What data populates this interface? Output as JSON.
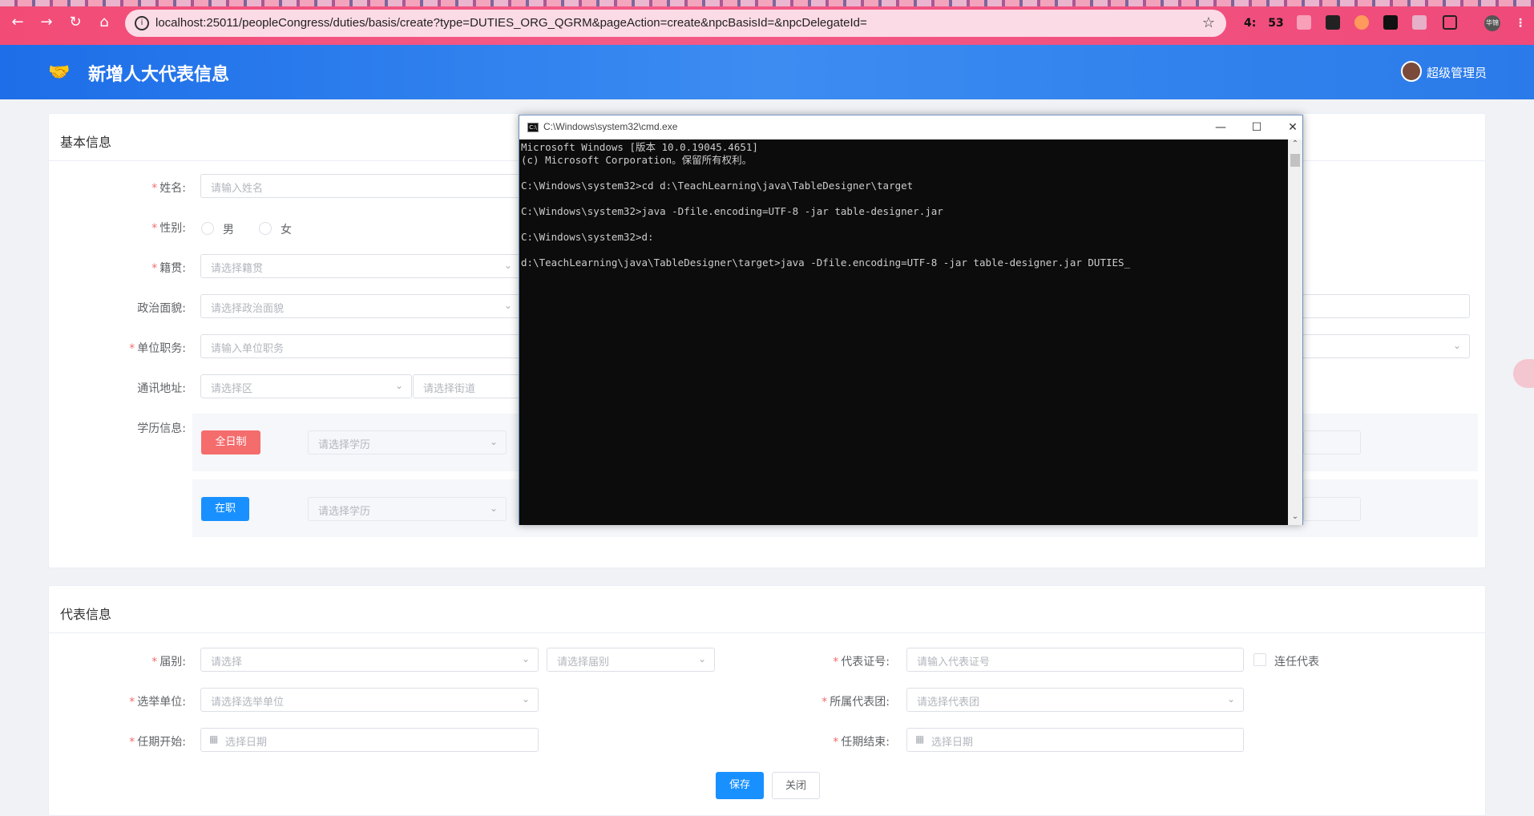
{
  "browser": {
    "url": "localhost:25011/peopleCongress/duties/basis/create?type=DUTIES_ORG_QGRM&pageAction=create&npcBasisId=&npcDelegateId=",
    "back": "←",
    "forward": "→",
    "reload": "↻",
    "home": "⌂",
    "star": "☆",
    "ext_text_1": "4:",
    "ext_text_2": "53",
    "profile": "华锦"
  },
  "header": {
    "logo": "🤝",
    "title": "新增人大代表信息",
    "user": "超级管理员"
  },
  "basic": {
    "title": "基本信息",
    "name_label": "姓名:",
    "name_placeholder": "请输入姓名",
    "gender_label": "性别:",
    "gender_male": "男",
    "gender_female": "女",
    "native_label": "籍贯:",
    "native_placeholder": "请选择籍贯",
    "politics_label": "政治面貌:",
    "politics_placeholder": "请选择政治面貌",
    "duty_label": "单位职务:",
    "duty_placeholder": "请输入单位职务",
    "address_label": "通讯地址:",
    "district_placeholder": "请选择区",
    "street_placeholder": "请选择街道",
    "edu_label": "学历信息:",
    "fulltime_btn": "全日制",
    "inservice_btn": "在职",
    "edu_placeholder": "请选择学历"
  },
  "delegate": {
    "title": "代表信息",
    "session_label": "届别:",
    "session_placeholder": "请选择",
    "session2_placeholder": "请选择届别",
    "cert_label": "代表证号:",
    "cert_placeholder": "请输入代表证号",
    "reelect_label": "连任代表",
    "unit_label": "选举单位:",
    "unit_placeholder": "请选择选举单位",
    "group_label": "所属代表团:",
    "group_placeholder": "请选择代表团",
    "start_label": "任期开始:",
    "end_label": "任期结束:",
    "date_placeholder": "选择日期"
  },
  "actions": {
    "save": "保存",
    "close": "关闭"
  },
  "cmd": {
    "title": "C:\\Windows\\system32\\cmd.exe",
    "lines": "Microsoft Windows [版本 10.0.19045.4651]\n(c) Microsoft Corporation。保留所有权利。\n\nC:\\Windows\\system32>cd d:\\TeachLearning\\java\\TableDesigner\\target\n\nC:\\Windows\\system32>java -Dfile.encoding=UTF-8 -jar table-designer.jar\n\nC:\\Windows\\system32>d:\n\nd:\\TeachLearning\\java\\TableDesigner\\target>java -Dfile.encoding=UTF-8 -jar table-designer.jar DUTIES_",
    "min": "—",
    "max": "☐",
    "close": "✕"
  }
}
